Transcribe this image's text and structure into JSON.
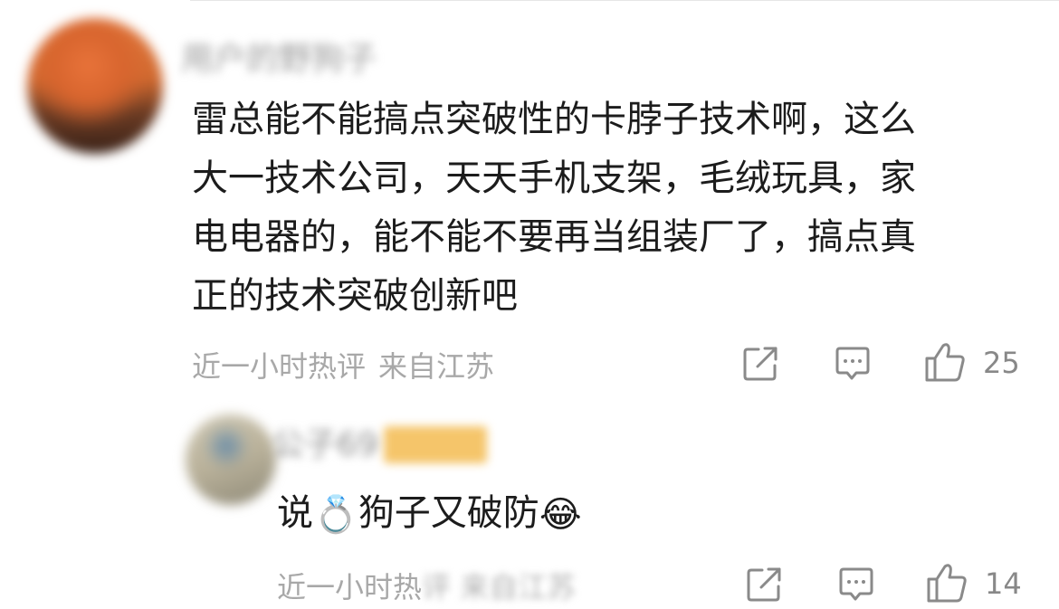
{
  "comments": [
    {
      "username": "用户的野狗子",
      "text_lines": [
        "雷总能不能搞点突破性的卡脖子技术啊，这么",
        "大一技术公司，天天手机支架，毛绒玩具，家",
        "电电器的，能不能不要再当组装厂了，搞点真",
        "正的技术突破创新吧"
      ],
      "time": "近一小时热评",
      "location": "来自江苏",
      "like_count": "25"
    },
    {
      "username": "公子69",
      "text_lines": [
        "说💍狗子又破防😂"
      ],
      "text_parts": [
        "说",
        "💍",
        "狗子又破防",
        "😂"
      ],
      "time": "近一小时热",
      "time_blurred": "评 来自江苏",
      "like_count": "14"
    }
  ],
  "icons": {
    "share": "share-icon",
    "reply": "comment-icon",
    "like": "thumbs-up-icon"
  },
  "colors": {
    "text": "#1c1c1c",
    "meta": "#a8a8a8",
    "icon": "#8a8a8a"
  }
}
